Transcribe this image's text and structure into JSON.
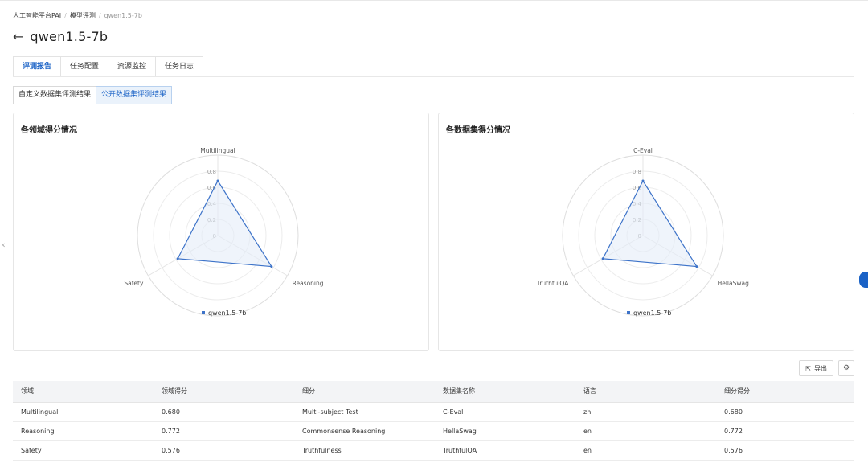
{
  "breadcrumb": [
    "人工智能平台PAI",
    "模型评测",
    "qwen1.5-7b"
  ],
  "page_title": "qwen1.5-7b",
  "tabs": [
    {
      "label": "评测报告",
      "active": true
    },
    {
      "label": "任务配置",
      "active": false
    },
    {
      "label": "资源监控",
      "active": false
    },
    {
      "label": "任务日志",
      "active": false
    }
  ],
  "subtabs": [
    {
      "label": "自定义数据集评测结果",
      "active": false
    },
    {
      "label": "公开数据集评测结果",
      "active": true
    }
  ],
  "colors": {
    "accent": "#1a62c6",
    "series": "#3d73c9",
    "series_fill": "#e4ecf8"
  },
  "chart_data": [
    {
      "type": "radar",
      "title": "各领域得分情况",
      "axes": [
        "Multilingual",
        "Reasoning",
        "Safety"
      ],
      "rings": [
        "0",
        "0.2",
        "0.4",
        "0.6",
        "0.8"
      ],
      "range": [
        0,
        0.8
      ],
      "series": [
        {
          "name": "qwen1.5-7b",
          "values": [
            0.68,
            0.772,
            0.576
          ]
        }
      ],
      "legend": "bottom"
    },
    {
      "type": "radar",
      "title": "各数据集得分情况",
      "axes": [
        "C-Eval",
        "HellaSwag",
        "TruthfulQA"
      ],
      "rings": [
        "0",
        "0.2",
        "0.4",
        "0.6",
        "0.8"
      ],
      "range": [
        0,
        0.8
      ],
      "series": [
        {
          "name": "qwen1.5-7b",
          "values": [
            0.68,
            0.772,
            0.576
          ]
        }
      ],
      "legend": "bottom"
    }
  ],
  "toolbar": {
    "export_label": "导出",
    "export_icon": "export-icon",
    "settings_icon": "gear-icon"
  },
  "table": {
    "headers": [
      "领域",
      "领域得分",
      "细分",
      "数据集名称",
      "语言",
      "细分得分"
    ],
    "rows": [
      [
        "Multilingual",
        "0.680",
        "Multi-subject Test",
        "C-Eval",
        "zh",
        "0.680"
      ],
      [
        "Reasoning",
        "0.772",
        "Commonsense Reasoning",
        "HellaSwag",
        "en",
        "0.772"
      ],
      [
        "Safety",
        "0.576",
        "Truthfulness",
        "TruthfulQA",
        "en",
        "0.576"
      ]
    ]
  }
}
